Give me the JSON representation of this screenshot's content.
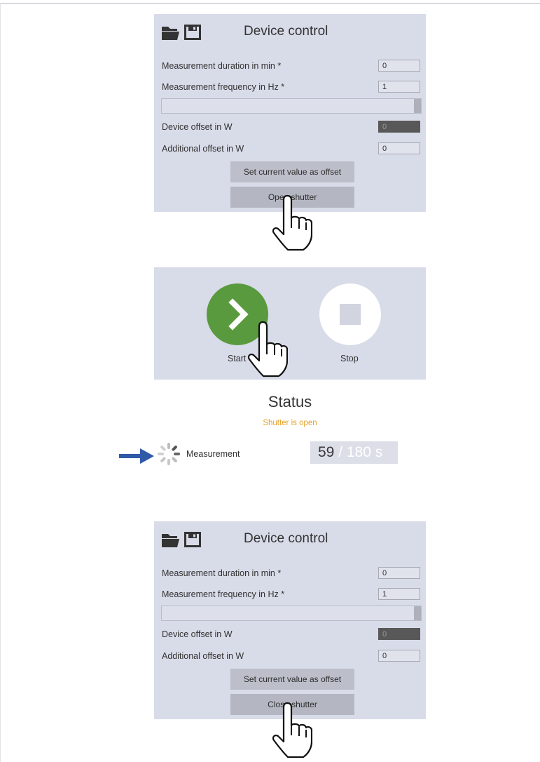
{
  "panel_top": {
    "title": "Device control",
    "fields": [
      {
        "label": "Measurement duration in min *",
        "value": "0"
      },
      {
        "label": "Measurement frequency in Hz *",
        "value": "1"
      },
      {
        "label": "Device offset in W",
        "value": "0"
      },
      {
        "label": "Additional offset in W",
        "value": "0"
      }
    ],
    "btn_offset": "Set current value as offset",
    "btn_shutter": "Open shutter"
  },
  "control": {
    "start_label": "Start",
    "stop_label": "Stop",
    "status_title": "Status",
    "status_text": "Shutter is open",
    "measurement_label": "Measurement",
    "counter_current": "59",
    "counter_total": " / 180  s"
  },
  "panel_bottom": {
    "title": "Device control",
    "fields": [
      {
        "label": "Measurement duration in min *",
        "value": "0"
      },
      {
        "label": "Measurement frequency in Hz *",
        "value": "1"
      },
      {
        "label": "Device offset in W",
        "value": "0"
      },
      {
        "label": "Additional offset in W",
        "value": "0"
      }
    ],
    "btn_offset": "Set current value as offset",
    "btn_shutter": "Close shutter"
  },
  "colors": {
    "panel_bg": "#d8dbe8",
    "start_green": "#5a9a3e",
    "status_orange": "#e2a12b",
    "arrow_blue": "#2f5aa8"
  },
  "icons": [
    "folder-icon",
    "save-icon",
    "hand-pointer-icon",
    "chevron-right-icon",
    "stop-square-icon",
    "spinner-icon",
    "arrow-right-icon"
  ]
}
